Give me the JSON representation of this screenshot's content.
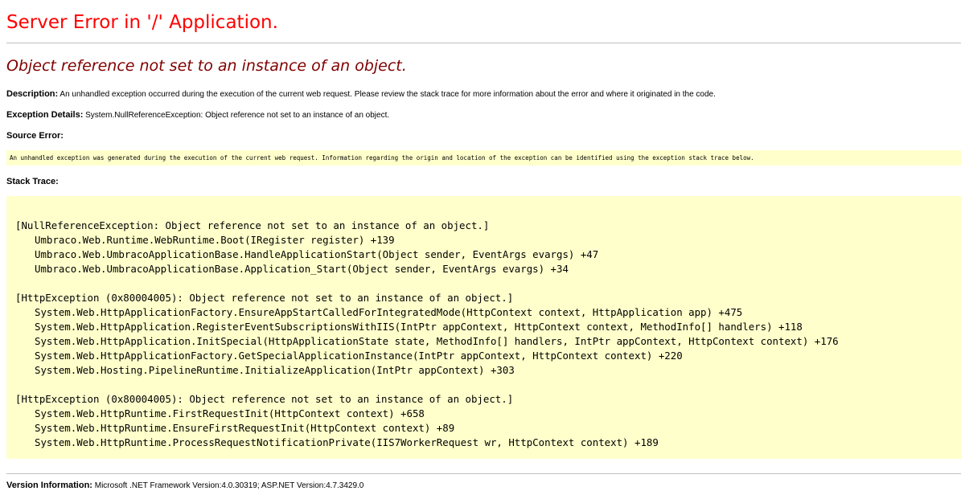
{
  "title": "Server Error in '/' Application.",
  "error_message": "Object reference not set to an instance of an object.",
  "description": {
    "label": "Description:",
    "text": "An unhandled exception occurred during the execution of the current web request. Please review the stack trace for more information about the error and where it originated in the code."
  },
  "exception_details": {
    "label": "Exception Details:",
    "text": "System.NullReferenceException: Object reference not set to an instance of an object."
  },
  "source_error": {
    "label": "Source Error:",
    "text": "An unhandled exception was generated during the execution of the current web request. Information regarding the origin and location of the exception can be identified using the exception stack trace below."
  },
  "stack_trace": {
    "label": "Stack Trace:",
    "lines": [
      {
        "text": "[NullReferenceException: Object reference not set to an instance of an object.]",
        "indent": false
      },
      {
        "text": "Umbraco.Web.Runtime.WebRuntime.Boot(IRegister register) +139",
        "indent": true
      },
      {
        "text": "Umbraco.Web.UmbracoApplicationBase.HandleApplicationStart(Object sender, EventArgs evargs) +47",
        "indent": true
      },
      {
        "text": "Umbraco.Web.UmbracoApplicationBase.Application_Start(Object sender, EventArgs evargs) +34",
        "indent": true
      },
      {
        "text": "",
        "indent": false
      },
      {
        "text": "[HttpException (0x80004005): Object reference not set to an instance of an object.]",
        "indent": false
      },
      {
        "text": "System.Web.HttpApplicationFactory.EnsureAppStartCalledForIntegratedMode(HttpContext context, HttpApplication app) +475",
        "indent": true
      },
      {
        "text": "System.Web.HttpApplication.RegisterEventSubscriptionsWithIIS(IntPtr appContext, HttpContext context, MethodInfo[] handlers) +118",
        "indent": true
      },
      {
        "text": "System.Web.HttpApplication.InitSpecial(HttpApplicationState state, MethodInfo[] handlers, IntPtr appContext, HttpContext context) +176",
        "indent": true
      },
      {
        "text": "System.Web.HttpApplicationFactory.GetSpecialApplicationInstance(IntPtr appContext, HttpContext context) +220",
        "indent": true
      },
      {
        "text": "System.Web.Hosting.PipelineRuntime.InitializeApplication(IntPtr appContext) +303",
        "indent": true
      },
      {
        "text": "",
        "indent": false
      },
      {
        "text": "[HttpException (0x80004005): Object reference not set to an instance of an object.]",
        "indent": false
      },
      {
        "text": "System.Web.HttpRuntime.FirstRequestInit(HttpContext context) +658",
        "indent": true
      },
      {
        "text": "System.Web.HttpRuntime.EnsureFirstRequestInit(HttpContext context) +89",
        "indent": true
      },
      {
        "text": "System.Web.HttpRuntime.ProcessRequestNotificationPrivate(IIS7WorkerRequest wr, HttpContext context) +189",
        "indent": true
      }
    ]
  },
  "version_info": {
    "label": "Version Information:",
    "text": "Microsoft .NET Framework Version:4.0.30319; ASP.NET Version:4.7.3429.0"
  },
  "colors": {
    "title": "#ff0000",
    "error_message": "#800000",
    "code_background": "#ffffcc",
    "rule": "#c0c0c0"
  }
}
